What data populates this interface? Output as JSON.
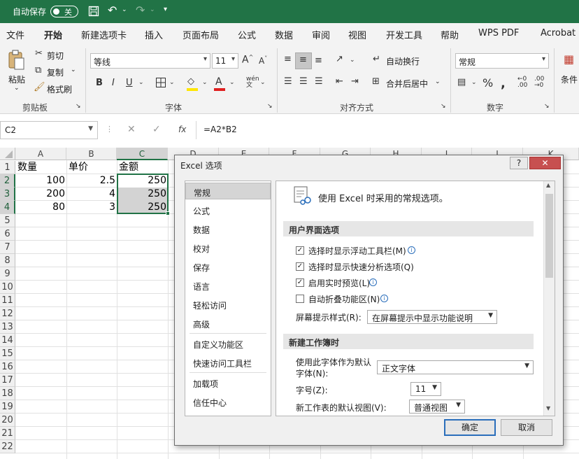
{
  "titlebar": {
    "autosave_label": "自动保存",
    "autosave_state": "关"
  },
  "menu": [
    "文件",
    "开始",
    "新建选项卡",
    "插入",
    "页面布局",
    "公式",
    "数据",
    "审阅",
    "视图",
    "开发工具",
    "帮助",
    "WPS PDF",
    "Acrobat"
  ],
  "ribbon": {
    "paste": "粘贴",
    "cut": "剪切",
    "copy": "复制",
    "format_painter": "格式刷",
    "clipboard_group": "剪贴板",
    "font_name": "等线",
    "font_size": "11",
    "font_group": "字体",
    "bold": "B",
    "italic": "I",
    "underline": "U",
    "wrap_text": "自动换行",
    "merge_center": "合并后居中",
    "align_group": "对齐方式",
    "number_format": "常规",
    "number_group": "数字",
    "conditional": "条件"
  },
  "formula_bar": {
    "name_box": "C2",
    "formula": "=A2*B2",
    "fx": "fx"
  },
  "sheet": {
    "columns": [
      "A",
      "B",
      "C",
      "D",
      "E",
      "F",
      "G",
      "H",
      "I",
      "J",
      "K"
    ],
    "rows": [
      "1",
      "2",
      "3",
      "4",
      "5",
      "6",
      "7",
      "8",
      "9",
      "10",
      "11",
      "12",
      "13",
      "14",
      "15",
      "16",
      "17",
      "18",
      "19",
      "20",
      "21",
      "22"
    ],
    "header": [
      "数量",
      "单价",
      "金额"
    ],
    "data": [
      [
        "100",
        "2.5",
        "250"
      ],
      [
        "200",
        "4",
        "250"
      ],
      [
        "80",
        "3",
        "250"
      ]
    ]
  },
  "dialog": {
    "title": "Excel 选项",
    "help": "?",
    "nav": [
      "常规",
      "公式",
      "数据",
      "校对",
      "保存",
      "语言",
      "轻松访问",
      "高级",
      "自定义功能区",
      "快速访问工具栏",
      "加载项",
      "信任中心"
    ],
    "intro": "使用 Excel 时采用的常规选项。",
    "section_ui": "用户界面选项",
    "opt_mini_toolbar": "选择时显示浮动工具栏(M)",
    "opt_quick_analysis": "选择时显示快速分析选项(Q)",
    "opt_live_preview": "启用实时预览(L)",
    "opt_collapse_ribbon": "自动折叠功能区(N)",
    "screentip_label": "屏幕提示样式(R):",
    "screentip_value": "在屏幕提示中显示功能说明",
    "section_new": "新建工作簿时",
    "font_label_1": "使用此字体作为默认",
    "font_label_2": "字体(N):",
    "font_value": "正文字体",
    "size_label": "字号(Z):",
    "size_value": "11",
    "view_label": "新工作表的默认视图(V):",
    "view_value": "普通视图",
    "ok": "确定",
    "cancel": "取消"
  }
}
